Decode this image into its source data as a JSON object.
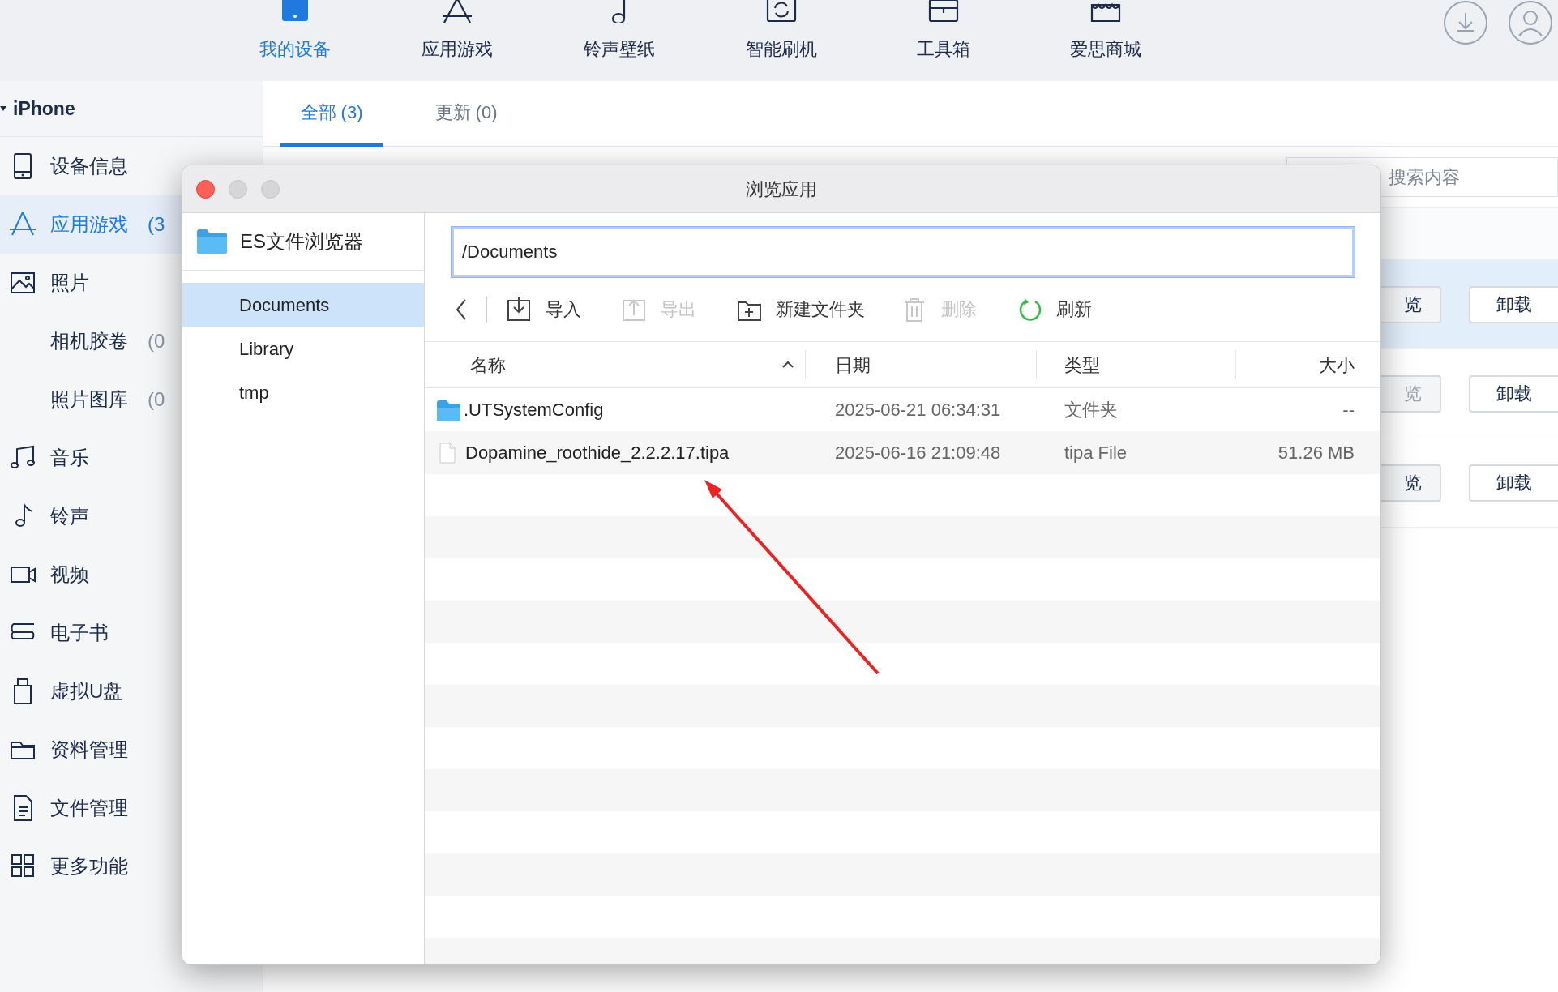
{
  "top_nav": {
    "items": [
      {
        "label": "我的设备",
        "selected": true
      },
      {
        "label": "应用游戏",
        "selected": false
      },
      {
        "label": "铃声壁纸",
        "selected": false
      },
      {
        "label": "智能刷机",
        "selected": false
      },
      {
        "label": "工具箱",
        "selected": false
      },
      {
        "label": "爱思商城",
        "selected": false
      }
    ]
  },
  "sidebar": {
    "device": "iPhone",
    "expanded": true,
    "items": [
      {
        "kind": "main",
        "label": "设备信息",
        "selected": false
      },
      {
        "kind": "main",
        "label": "应用游戏",
        "count": "(3",
        "selected": true
      },
      {
        "kind": "main",
        "label": "照片",
        "selected": false
      },
      {
        "kind": "sub",
        "label": "相机胶卷",
        "count": "(0",
        "selected": false
      },
      {
        "kind": "sub",
        "label": "照片图库",
        "count": "(0",
        "selected": false
      },
      {
        "kind": "main",
        "label": "音乐",
        "selected": false
      },
      {
        "kind": "main",
        "label": "铃声",
        "selected": false
      },
      {
        "kind": "main",
        "label": "视频",
        "selected": false
      },
      {
        "kind": "main",
        "label": "电子书",
        "selected": false
      },
      {
        "kind": "main",
        "label": "虚拟U盘",
        "selected": false
      },
      {
        "kind": "main",
        "label": "资料管理",
        "selected": false
      },
      {
        "kind": "main",
        "label": "文件管理",
        "selected": false
      },
      {
        "kind": "main",
        "label": "更多功能",
        "selected": false
      }
    ]
  },
  "tabs": [
    {
      "label": "全部 (3)",
      "selected": true
    },
    {
      "label": "更新 (0)",
      "selected": false
    }
  ],
  "search": {
    "placeholder": "搜索内容"
  },
  "app_rows": [
    {
      "selected": true,
      "browse": "览",
      "browse_disabled": false,
      "uninstall": "卸载"
    },
    {
      "selected": false,
      "browse": "览",
      "browse_disabled": true,
      "uninstall": "卸载"
    },
    {
      "selected": false,
      "browse": "览",
      "browse_disabled": false,
      "uninstall": "卸载"
    }
  ],
  "dialog": {
    "title": "浏览应用",
    "app": "ES文件浏览器",
    "folders": [
      {
        "label": "Documents",
        "selected": true
      },
      {
        "label": "Library",
        "selected": false
      },
      {
        "label": "tmp",
        "selected": false
      }
    ],
    "path": "/Documents",
    "toolbar": [
      {
        "kind": "import",
        "label": "导入",
        "disabled": false
      },
      {
        "kind": "export",
        "label": "导出",
        "disabled": true
      },
      {
        "kind": "new_folder",
        "label": "新建文件夹",
        "disabled": false
      },
      {
        "kind": "delete",
        "label": "删除",
        "disabled": true
      },
      {
        "kind": "refresh",
        "label": "刷新",
        "disabled": false
      }
    ],
    "columns": [
      {
        "label": "名称",
        "sorted": true
      },
      {
        "label": "日期",
        "sorted": false
      },
      {
        "label": "类型",
        "sorted": false
      },
      {
        "label": "大小",
        "sorted": false
      }
    ],
    "files": [
      {
        "kind": "folder",
        "name": ".UTSystemConfig",
        "date": "2025-06-21 06:34:31",
        "type": "文件夹",
        "size": "--"
      },
      {
        "kind": "file",
        "name": "Dopamine_roothide_2.2.2.17.tipa",
        "date": "2025-06-16 21:09:48",
        "type": "tipa File",
        "size": "51.26 MB"
      }
    ]
  }
}
